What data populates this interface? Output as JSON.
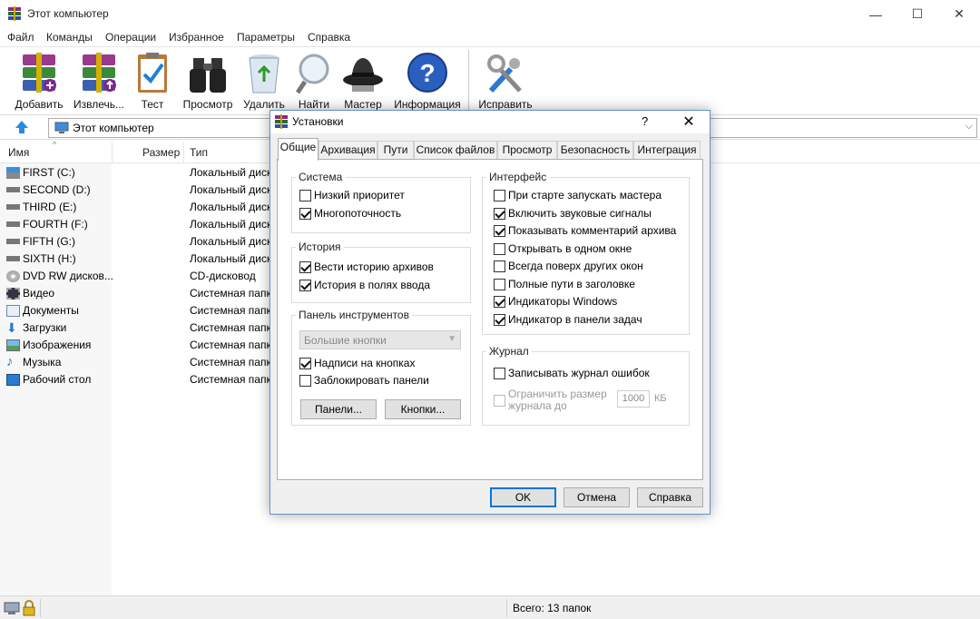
{
  "window": {
    "title": "Этот компьютер",
    "min": "—",
    "max": "☐",
    "close": "✕"
  },
  "menu": [
    "Файл",
    "Команды",
    "Операции",
    "Избранное",
    "Параметры",
    "Справка"
  ],
  "toolbar": [
    "Добавить",
    "Извлечь...",
    "Тест",
    "Просмотр",
    "Удалить",
    "Найти",
    "Мастер",
    "Информация",
    "Исправить"
  ],
  "address": {
    "text": "Этот компьютер"
  },
  "columns": {
    "name": "Имя",
    "size": "Размер",
    "type": "Тип"
  },
  "files": [
    {
      "name": "FIRST (C:)",
      "type": "Локальный диск",
      "icon": "system-drive-icon"
    },
    {
      "name": "SECOND (D:)",
      "type": "Локальный диск",
      "icon": "drive-icon"
    },
    {
      "name": "THIRD (E:)",
      "type": "Локальный диск",
      "icon": "drive-icon"
    },
    {
      "name": "FOURTH (F:)",
      "type": "Локальный диск",
      "icon": "drive-icon"
    },
    {
      "name": "FIFTH (G:)",
      "type": "Локальный диск",
      "icon": "drive-icon"
    },
    {
      "name": "SIXTH (H:)",
      "type": "Локальный диск",
      "icon": "drive-icon"
    },
    {
      "name": "DVD RW дисков...",
      "type": "CD-дисковод",
      "icon": "dvd-icon"
    },
    {
      "name": "Видео",
      "type": "Системная папка",
      "icon": "video-folder-icon"
    },
    {
      "name": "Документы",
      "type": "Системная папка",
      "icon": "documents-folder-icon"
    },
    {
      "name": "Загрузки",
      "type": "Системная папка",
      "icon": "downloads-folder-icon"
    },
    {
      "name": "Изображения",
      "type": "Системная папка",
      "icon": "pictures-folder-icon"
    },
    {
      "name": "Музыка",
      "type": "Системная папка",
      "icon": "music-folder-icon"
    },
    {
      "name": "Рабочий стол",
      "type": "Системная папка",
      "icon": "desktop-folder-icon"
    }
  ],
  "status": {
    "text": "Всего: 13 папок"
  },
  "dialog": {
    "title": "Установки",
    "help": "?",
    "close": "✕",
    "tabs": [
      "Общие",
      "Архивация",
      "Пути",
      "Список файлов",
      "Просмотр",
      "Безопасность",
      "Интеграция"
    ],
    "active_tab": "Общие",
    "system": {
      "title": "Система",
      "items": [
        {
          "label": "Низкий приоритет",
          "checked": false
        },
        {
          "label": "Многопоточность",
          "checked": true
        }
      ]
    },
    "history": {
      "title": "История",
      "items": [
        {
          "label": "Вести историю архивов",
          "checked": true
        },
        {
          "label": "История в полях ввода",
          "checked": true
        }
      ]
    },
    "toolbar_panel": {
      "title": "Панель инструментов",
      "combo": "Большие кнопки",
      "items": [
        {
          "label": "Надписи на кнопках",
          "checked": true
        },
        {
          "label": "Заблокировать панели",
          "checked": false
        }
      ],
      "panels_btn": "Панели...",
      "buttons_btn": "Кнопки..."
    },
    "interface": {
      "title": "Интерфейс",
      "items": [
        {
          "label": "При старте запускать мастера",
          "checked": false
        },
        {
          "label": "Включить звуковые сигналы",
          "checked": true
        },
        {
          "label": "Показывать комментарий архива",
          "checked": true
        },
        {
          "label": "Открывать в одном окне",
          "checked": false
        },
        {
          "label": "Всегда поверх других окон",
          "checked": false
        },
        {
          "label": "Полные пути в заголовке",
          "checked": false
        },
        {
          "label": "Индикаторы Windows",
          "checked": true
        },
        {
          "label": "Индикатор в панели задач",
          "checked": true
        }
      ]
    },
    "journal": {
      "title": "Журнал",
      "items": [
        {
          "label": "Записывать журнал ошибок",
          "checked": false
        }
      ],
      "limit_line1": "Ограничить размер",
      "limit_line2": "журнала до",
      "size": "1000",
      "unit": "КБ"
    },
    "ok": "OK",
    "cancel": "Отмена",
    "help_btn": "Справка"
  }
}
